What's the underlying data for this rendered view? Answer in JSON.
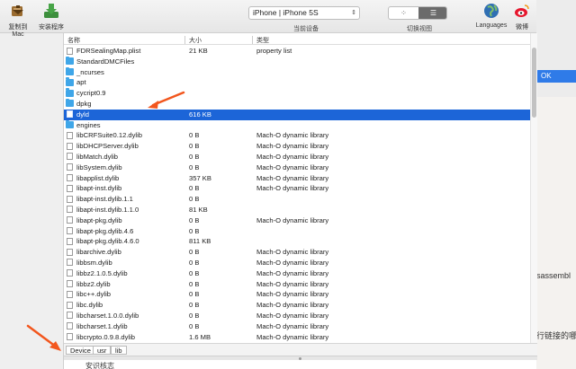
{
  "toolbar": {
    "copy_to_mac": "复制到Mac",
    "install_app": "安装程序",
    "device": "iPhone | iPhone 5S",
    "device_label": "当前设备",
    "view_label": "切换视图",
    "languages": "Languages",
    "weibo": "微博"
  },
  "columns": {
    "name": "名称",
    "size": "大小",
    "kind": "类型"
  },
  "files": [
    {
      "name": "FDRSealingMap.plist",
      "size": "21 KB",
      "kind": "property list",
      "type": "file"
    },
    {
      "name": "StandardDMCFiles",
      "size": "",
      "kind": "",
      "type": "folder"
    },
    {
      "name": "_ncurses",
      "size": "",
      "kind": "",
      "type": "folder"
    },
    {
      "name": "apt",
      "size": "",
      "kind": "",
      "type": "folder"
    },
    {
      "name": "cycript0.9",
      "size": "",
      "kind": "",
      "type": "folder"
    },
    {
      "name": "dpkg",
      "size": "",
      "kind": "",
      "type": "folder"
    },
    {
      "name": "dyld",
      "size": "616 KB",
      "kind": "",
      "type": "file",
      "selected": true
    },
    {
      "name": "engines",
      "size": "",
      "kind": "",
      "type": "folder"
    },
    {
      "name": "libCRFSuite0.12.dylib",
      "size": "0 B",
      "kind": "Mach-O dynamic library",
      "type": "file"
    },
    {
      "name": "libDHCPServer.dylib",
      "size": "0 B",
      "kind": "Mach-O dynamic library",
      "type": "file"
    },
    {
      "name": "libMatch.dylib",
      "size": "0 B",
      "kind": "Mach-O dynamic library",
      "type": "file"
    },
    {
      "name": "libSystem.dylib",
      "size": "0 B",
      "kind": "Mach-O dynamic library",
      "type": "file"
    },
    {
      "name": "libapplist.dylib",
      "size": "357 KB",
      "kind": "Mach-O dynamic library",
      "type": "file"
    },
    {
      "name": "libapt-inst.dylib",
      "size": "0 B",
      "kind": "Mach-O dynamic library",
      "type": "file"
    },
    {
      "name": "libapt-inst.dylib.1.1",
      "size": "0 B",
      "kind": "",
      "type": "file"
    },
    {
      "name": "libapt-inst.dylib.1.1.0",
      "size": "81 KB",
      "kind": "",
      "type": "file"
    },
    {
      "name": "libapt-pkg.dylib",
      "size": "0 B",
      "kind": "Mach-O dynamic library",
      "type": "file"
    },
    {
      "name": "libapt-pkg.dylib.4.6",
      "size": "0 B",
      "kind": "",
      "type": "file"
    },
    {
      "name": "libapt-pkg.dylib.4.6.0",
      "size": "811 KB",
      "kind": "",
      "type": "file"
    },
    {
      "name": "libarchive.dylib",
      "size": "0 B",
      "kind": "Mach-O dynamic library",
      "type": "file"
    },
    {
      "name": "libbsm.dylib",
      "size": "0 B",
      "kind": "Mach-O dynamic library",
      "type": "file"
    },
    {
      "name": "libbz2.1.0.5.dylib",
      "size": "0 B",
      "kind": "Mach-O dynamic library",
      "type": "file"
    },
    {
      "name": "libbz2.dylib",
      "size": "0 B",
      "kind": "Mach-O dynamic library",
      "type": "file"
    },
    {
      "name": "libc++.dylib",
      "size": "0 B",
      "kind": "Mach-O dynamic library",
      "type": "file"
    },
    {
      "name": "libc.dylib",
      "size": "0 B",
      "kind": "Mach-O dynamic library",
      "type": "file"
    },
    {
      "name": "libcharset.1.0.0.dylib",
      "size": "0 B",
      "kind": "Mach-O dynamic library",
      "type": "file"
    },
    {
      "name": "libcharset.1.dylib",
      "size": "0 B",
      "kind": "Mach-O dynamic library",
      "type": "file"
    },
    {
      "name": "libcrypto.0.9.8.dylib",
      "size": "1.6 MB",
      "kind": "Mach-O dynamic library",
      "type": "file"
    }
  ],
  "path": [
    "Device",
    "usr",
    "lib"
  ],
  "background": {
    "ok_button": "OK",
    "fragment_1": "isassembl",
    "fragment_2": "行链接的哪",
    "bottom_text": "安识核志"
  },
  "colors": {
    "selection": "#1c65d8",
    "folder": "#3fa6e8",
    "arrow": "#f2561d"
  }
}
